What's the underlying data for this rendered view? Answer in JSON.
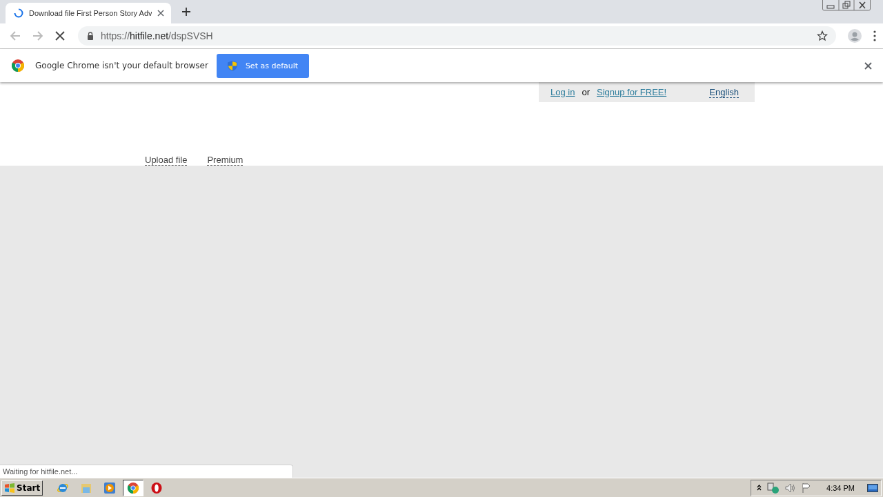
{
  "tab": {
    "title": "Download file First Person Story Adv",
    "loading": true
  },
  "address": {
    "scheme": "https://",
    "host": "hitfile.net",
    "path": "/dspSVSH"
  },
  "infobar": {
    "message": "Google Chrome isn't your default browser",
    "button": "Set as default"
  },
  "header": {
    "login": "Log in",
    "separator": "or",
    "signup": "Signup for FREE!",
    "language": "English"
  },
  "nav": [
    "Upload file",
    "Premium"
  ],
  "status_bubble": "Waiting for hitfile.net...",
  "taskbar": {
    "start": "Start",
    "apps": [
      {
        "kind": "ie",
        "selected": false
      },
      {
        "kind": "folder",
        "selected": false
      },
      {
        "kind": "media",
        "selected": false
      },
      {
        "kind": "chrome",
        "selected": true
      },
      {
        "kind": "opera",
        "selected": false
      }
    ],
    "clock": "4:34 PM"
  }
}
